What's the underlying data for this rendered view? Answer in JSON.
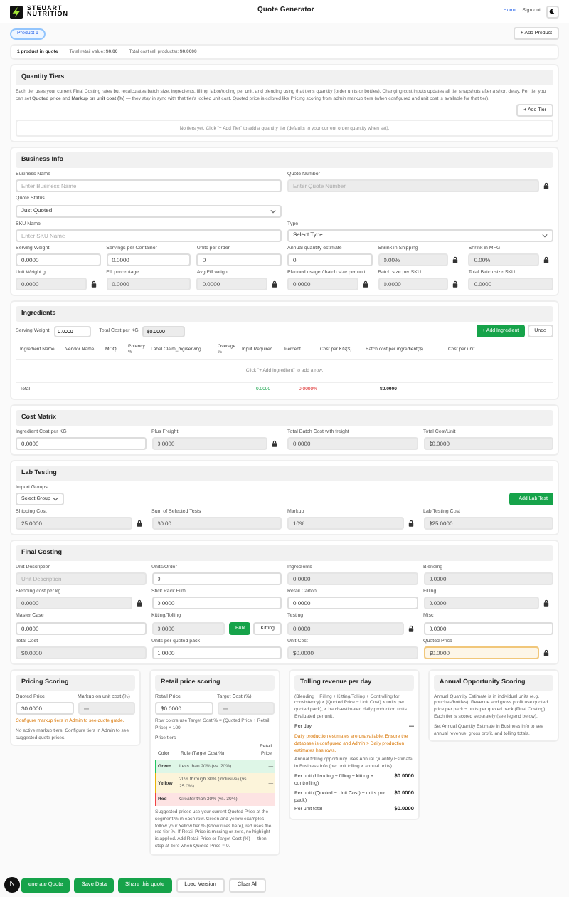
{
  "header": {
    "brand_top": "STEUART",
    "brand_bottom": "NUTRITION",
    "title": "Quote Generator",
    "links": [
      {
        "label": "Home",
        "selected": true
      },
      {
        "label": "Sign out",
        "selected": false
      }
    ]
  },
  "products": {
    "tabs": [
      {
        "label": "Product 1",
        "selected": true
      }
    ],
    "add_button": "+ Add Product"
  },
  "summary": [
    "1 product in quote",
    "Total retail value: **$0.00**",
    "Total cost (all products): **$0.0000**"
  ],
  "quantity_tiers": {
    "title": "Quantity Tiers",
    "description": "Each tier uses your current Final Costing rates but recalculates batch size, ingredients, filling, labor/tooling per unit, and blending using that tier's quantity (order units or bottles). Changing cost inputs updates all tier snapshots after a short delay. Per tier you can set **Quoted price** and **Markup on unit cost (%)** — they stay in sync with that tier's locked unit cost. Quoted price is colored like Pricing scoring from admin markup tiers (when configured and unit cost is available for that tier).",
    "add_button": "+ Add Tier",
    "empty": "No tiers yet. Click \"+ Add Tier\" to add a quantity tier (defaults to your current order quantity when set)."
  },
  "business_info": {
    "title": "Business Info",
    "rows": [
      [
        {
          "label": "Business Name",
          "placeholder": "Enter Business Name",
          "kind": "input"
        },
        {
          "label": "Quote Number",
          "placeholder": "Enter Quote Number",
          "kind": "locked"
        }
      ],
      [
        {
          "label": "Quote Status",
          "value": "Just Quoted",
          "kind": "select"
        }
      ],
      [
        {
          "label": "SKU Name",
          "placeholder": "Enter SKU Name",
          "kind": "input"
        },
        {
          "label": "Type",
          "value": "Select Type",
          "kind": "select"
        }
      ],
      [
        {
          "label": "Serving Weight",
          "value": "0.0000",
          "kind": "input"
        },
        {
          "label": "Servings per Container",
          "value": "0.0000",
          "kind": "input"
        },
        {
          "label": "Units per order",
          "value": "0",
          "kind": "input"
        },
        {
          "label": "Annual quantity estimate",
          "value": "0",
          "kind": "input"
        },
        {
          "label": "Shrink in Shipping",
          "value": "0.00%",
          "kind": "locked"
        },
        {
          "label": "Shrink in MFG",
          "value": "0.00%",
          "kind": "locked"
        }
      ],
      [
        {
          "label": "Unit Weight g",
          "value": "0.0000",
          "kind": "locked"
        },
        {
          "label": "Fill percentage",
          "value": "0.0000",
          "kind": "readonly"
        },
        {
          "label": "Avg Fill weight",
          "value": "0.0000",
          "kind": "locked"
        },
        {
          "label": "Planned usage / batch size per unit",
          "value": "0.0000",
          "kind": "locked"
        },
        {
          "label": "Batch size per SKU",
          "value": "0.0000",
          "kind": "locked"
        },
        {
          "label": "Total Batch size SKU",
          "value": "0.0000",
          "kind": "readonly"
        }
      ]
    ]
  },
  "ingredients": {
    "title": "Ingredients",
    "serving_weight_label": "Serving Weight",
    "serving_weight": "0.0000",
    "total_cost_label": "Total Cost per KG",
    "total_cost": "$0.0000",
    "add_button": "+ Add Ingredient",
    "undo_button": "Undo",
    "columns": [
      "Ingredient Name",
      "Vendor Name",
      "MOQ",
      "Potency %",
      "Label Claim_mg/serving",
      "Overage %",
      "Input Required",
      "Percent",
      "Cost per KG($)",
      "Batch cost per ingredient($)",
      "Cost per unit"
    ],
    "empty": "Click \"+ Add Ingredient\" to add a row.",
    "total": {
      "label": "Total",
      "input_required": "0.0000",
      "percent": "0.0000%",
      "batch_cost": "$0.0000"
    }
  },
  "cost_matrix": {
    "title": "Cost Matrix",
    "rows": [
      [
        {
          "label": "Ingredient Cost per KG",
          "value": "0.0000",
          "kind": "input"
        },
        {
          "label": "Plus Freight",
          "value": "0.0000",
          "kind": "locked"
        },
        {
          "label": "Total Batch Cost with freight",
          "value": "0.0000",
          "kind": "readonly"
        },
        {
          "label": "Total Cost/Unit",
          "value": "$0.0000",
          "kind": "readonly"
        }
      ]
    ]
  },
  "lab_testing": {
    "title": "Lab Testing",
    "import_label": "Import Groups",
    "import_value": "Select Group",
    "add_button": "+ Add Lab Test",
    "rows": [
      [
        {
          "label": "Shipping Cost",
          "value": "25.0000",
          "kind": "locked"
        },
        {
          "label": "Sum of Selected Tests",
          "value": "$0.00",
          "kind": "readonly"
        },
        {
          "label": "Markup",
          "value": "10%",
          "kind": "locked"
        },
        {
          "label": "Lab Testing Cost",
          "value": "$25.0000",
          "kind": "readonly"
        }
      ]
    ]
  },
  "final_costing": {
    "title": "Final Costing",
    "rows": [
      [
        {
          "label": "Unit Description",
          "placeholder": "Unit Description",
          "kind": "readonly"
        },
        {
          "label": "Units/Order",
          "value": "0",
          "kind": "input"
        },
        {
          "label": "Ingredients",
          "value": "0.0000",
          "kind": "readonly"
        },
        {
          "label": "Blending",
          "value": "0.0000",
          "kind": "readonly"
        }
      ],
      [
        {
          "label": "Blending cost per kg",
          "value": "0.0000",
          "kind": "locked"
        },
        {
          "label": "Stick Pack Film",
          "value": "0.0000",
          "kind": "input"
        },
        {
          "label": "Retail Carton",
          "value": "0.0000",
          "kind": "input"
        },
        {
          "label": "Filling",
          "value": "0.0000",
          "kind": "locked"
        }
      ],
      [
        {
          "label": "Master Case",
          "value": "0.0000",
          "kind": "input"
        },
        {
          "label": "Kitting/Tolling",
          "value": "0.0000",
          "kind": "readonly",
          "toggle": [
            {
              "label": "Bulk",
              "selected": true
            },
            {
              "label": "Kitting",
              "selected": false
            }
          ]
        },
        {
          "label": "Testing",
          "value": "0.0000",
          "kind": "locked"
        },
        {
          "label": "Misc",
          "value": "0.0000",
          "kind": "input"
        }
      ],
      [
        {
          "label": "Total Cost",
          "value": "$0.0000",
          "kind": "readonly"
        },
        {
          "label": "Units per quoted pack",
          "value": "1.0000",
          "kind": "input"
        },
        {
          "label": "Unit Cost",
          "value": "$0.0000",
          "kind": "readonly"
        },
        {
          "label": "Quoted Price",
          "value": "$0.0000",
          "kind": "accent"
        }
      ]
    ]
  },
  "pricing_scoring": {
    "title": "Pricing Scoring",
    "fields": [
      {
        "label": "Quoted Price",
        "value": "$0.0000",
        "kind": "input"
      },
      {
        "label": "Markup on unit cost (%)",
        "value": "—",
        "kind": "readonly"
      }
    ],
    "warning": "Configure markup tiers in Admin to see quote grade.",
    "note": "No active markup tiers. Configure tiers in Admin to see suggested quote prices."
  },
  "retail_scoring": {
    "title": "Retail price scoring",
    "fields": [
      {
        "label": "Retail Price",
        "value": "$0.0000",
        "kind": "input"
      },
      {
        "label": "Target Cost (%)",
        "value": "—",
        "kind": "readonly"
      }
    ],
    "note": "Row colors use Target Cost % = (Quoted Price ÷ Retail Price) × 100.",
    "tiers_label": "Price tiers",
    "columns": [
      "Color",
      "Rule (Target Cost %)",
      "Retail Price"
    ],
    "rows": [
      {
        "name": "Green",
        "rule": "Less than 20% (vs. 20%)",
        "price": "—",
        "color": "#22c55e"
      },
      {
        "name": "Yellow",
        "rule": "20% through 30% (inclusive) (vs. 25.0%)",
        "price": "—",
        "color": "#eab308"
      },
      {
        "name": "Red",
        "rule": "Greater than 30% (vs. 30%)",
        "price": "—",
        "color": "#ef4444"
      }
    ],
    "footer": "Suggested prices use your current Quoted Price at the segment % in each row. Green and yellow examples follow your Yellow tier % (show rules here), red uses the red tier %. If Retail Price is missing or zero, no highlight is applied. Add Retail Price or Target Cost (%) — then stop at zero when Quoted Price = 0."
  },
  "tolling": {
    "title": "Tolling revenue per day",
    "description": "(Blending + Filling + Kitting/Tolling + Controlling for consistency) × (Quoted Price − Unit Cost) × units per quoted pack), × batch-estimated daily production units. Evaluated per unit.",
    "per_day_label": "Per day",
    "per_day": "—",
    "warning": "Daily production estimates are unavailable. Ensure the database is configured and Admin > Daily production estimates has rows.",
    "note": "Annual tolling opportunity uses Annual Quantity Estimate in Business Info (per unit tolling × annual units).",
    "lines": [
      {
        "label": "Per unit (blending + filling + kitting + controlling)",
        "value": "$0.0000"
      },
      {
        "label": "Per unit ((Quoted − Unit Cost) ÷ units per pack)",
        "value": "$0.0000"
      },
      {
        "label": "Per unit total",
        "value": "$0.0000"
      }
    ]
  },
  "annual": {
    "title": "Annual Opportunity Scoring",
    "description": "Annual Quantity Estimate is in individual units (e.g. pouches/bottles). Revenue and gross profit use quoted price per pack ÷ units per quoted pack (Final Costing). Each tier is scored separately (see legend below).",
    "note": "Set Annual Quantity Estimate in Business Info to see annual revenue, gross profit, and tolling totals."
  },
  "actions": [
    {
      "label": "enerate Quote",
      "kind": "primary"
    },
    {
      "label": "Save Data",
      "kind": "primary"
    },
    {
      "label": "Share this quote",
      "kind": "primary"
    },
    {
      "label": "Load Version",
      "kind": "secondary"
    },
    {
      "label": "Clear All",
      "kind": "secondary"
    }
  ],
  "dev_badge": "N"
}
